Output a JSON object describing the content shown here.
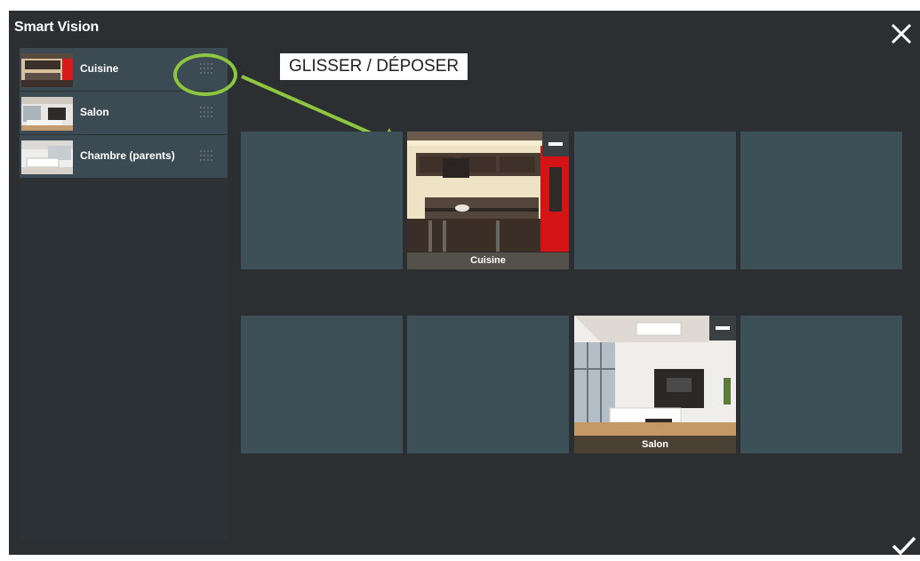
{
  "window": {
    "title": "Smart Vision"
  },
  "toolbar": {
    "close_icon": "close-icon",
    "confirm_icon": "check-icon"
  },
  "sidebar": {
    "items": [
      {
        "label": "Cuisine",
        "thumb": "kitchen"
      },
      {
        "label": "Salon",
        "thumb": "living-room"
      },
      {
        "label": "Chambre (parents)",
        "thumb": "bedroom"
      }
    ]
  },
  "annotation": {
    "callout": "GLISSER / DÉPOSER",
    "ring_color": "#8dc63f",
    "arrow_color": "#8dc63f"
  },
  "grid": {
    "slots": [
      {
        "filled": false,
        "caption": ""
      },
      {
        "filled": true,
        "caption": "Cuisine",
        "scene": "kitchen"
      },
      {
        "filled": false,
        "caption": ""
      },
      {
        "filled": false,
        "caption": ""
      },
      {
        "filled": false,
        "caption": ""
      },
      {
        "filled": false,
        "caption": ""
      },
      {
        "filled": true,
        "caption": "Salon",
        "scene": "living-room"
      },
      {
        "filled": false,
        "caption": ""
      }
    ]
  },
  "colors": {
    "background": "#2b2f31",
    "slot": "#3d4f57",
    "sidebar_item": "#3c4a53"
  }
}
